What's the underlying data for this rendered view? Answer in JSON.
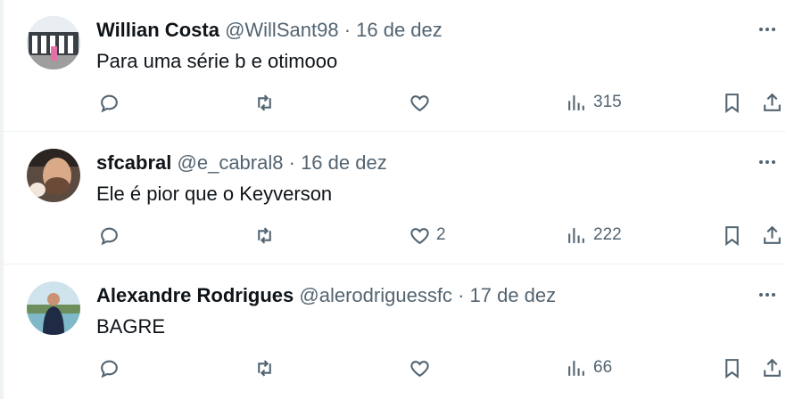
{
  "tweets": [
    {
      "name": "Willian Costa",
      "handle": "@WillSant98",
      "sep": "·",
      "date": "16 de dez",
      "text": "Para uma série b e otimooo",
      "likes": "",
      "views": "315"
    },
    {
      "name": "sfcabral",
      "handle": "@e_cabral8",
      "sep": "·",
      "date": "16 de dez",
      "text": "Ele é pior que o Keyverson",
      "likes": "2",
      "views": "222"
    },
    {
      "name": "Alexandre Rodrigues",
      "handle": "@alerodriguessfc",
      "sep": "·",
      "date": "17 de dez",
      "text": "BAGRE",
      "likes": "",
      "views": "66"
    }
  ],
  "icons": {
    "reply": "reply-icon",
    "retweet": "retweet-icon",
    "like": "heart-icon",
    "views": "views-icon",
    "bookmark": "bookmark-icon",
    "share": "share-icon",
    "more": "more-icon"
  },
  "colors": {
    "text": "#0f1419",
    "secondary": "#536471",
    "divider": "#eff3f4"
  }
}
